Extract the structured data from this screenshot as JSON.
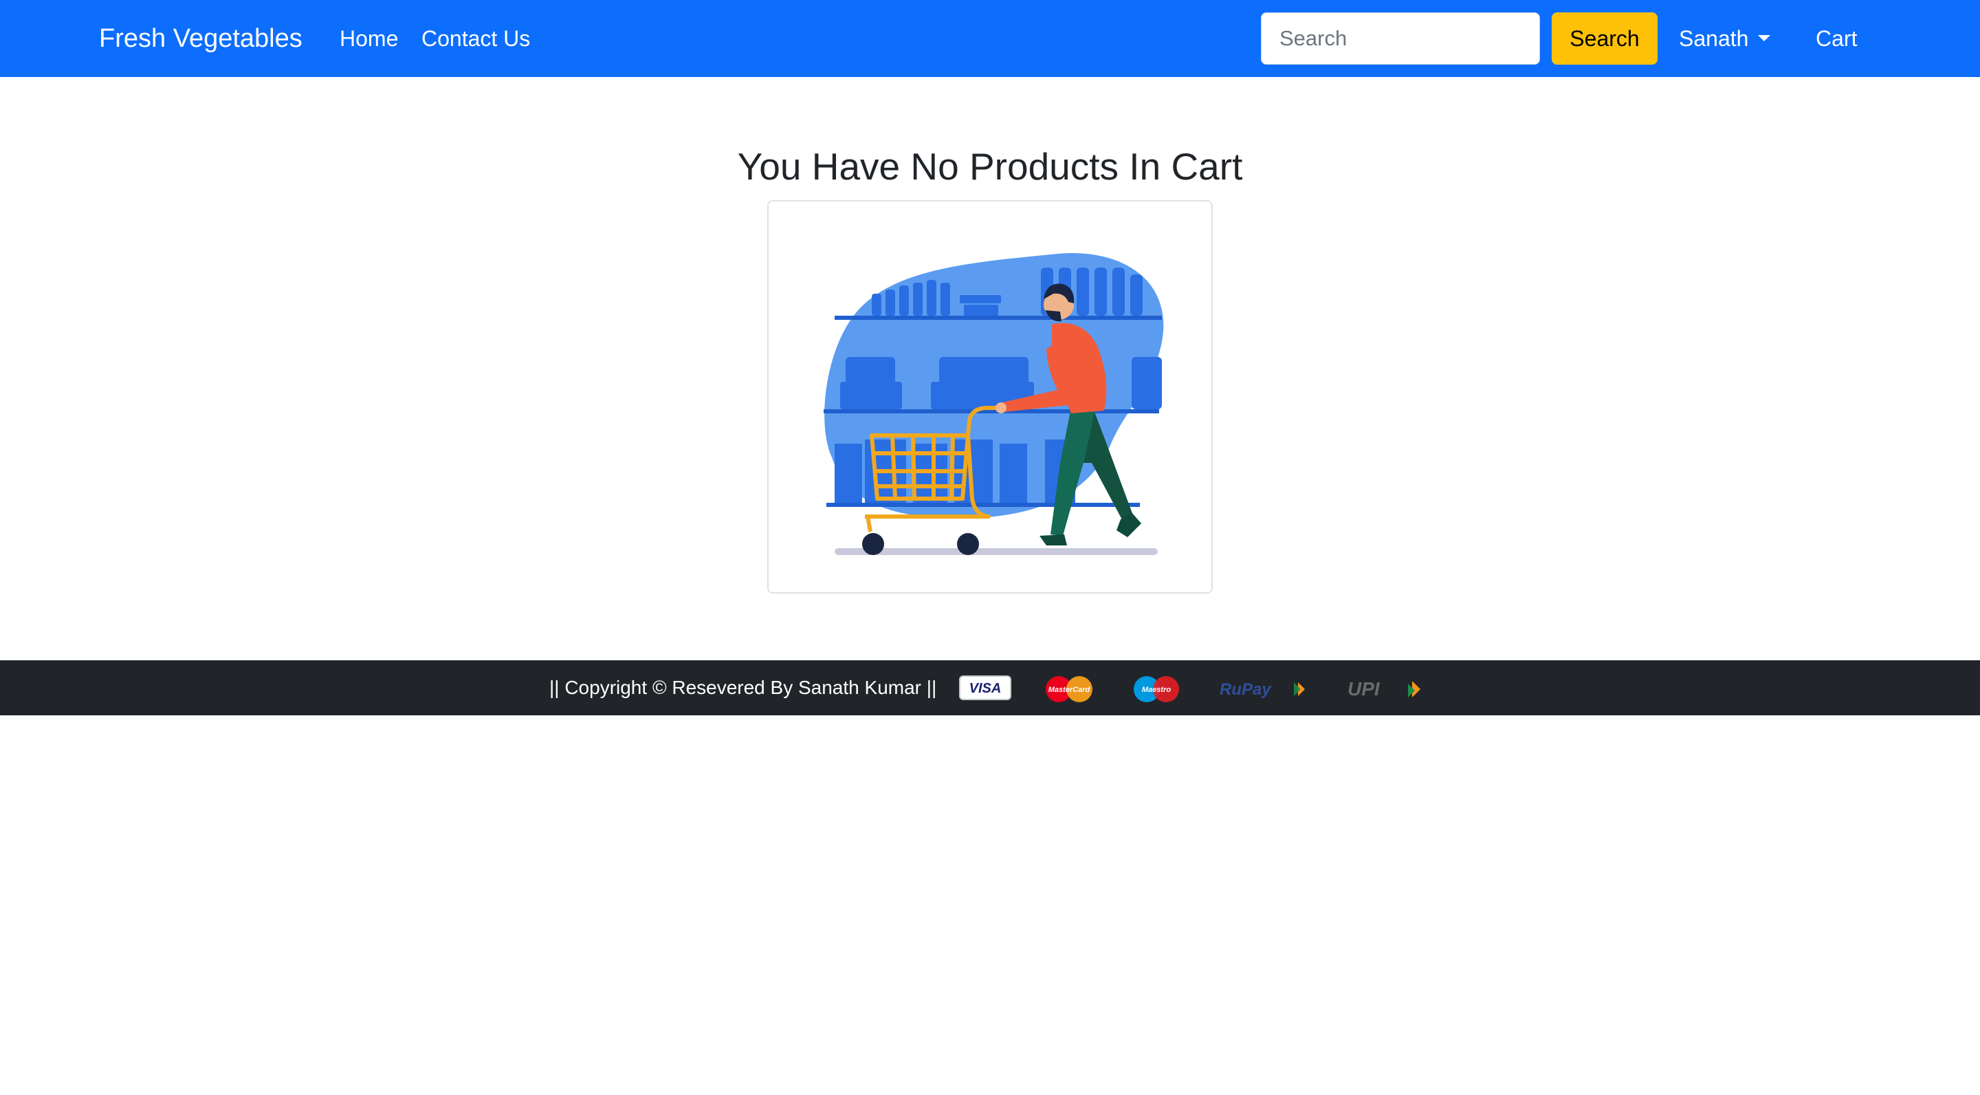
{
  "navbar": {
    "brand": "Fresh Vegetables",
    "links": [
      "Home",
      "Contact Us"
    ],
    "search": {
      "placeholder": "Search",
      "button_label": "Search"
    },
    "user": "Sanath",
    "cart_label": "Cart",
    "background_color": "#0d6efd",
    "search_button_color": "#ffc107"
  },
  "main": {
    "heading": "You Have No Products In Cart",
    "illustration": "empty-cart-shopper-illustration"
  },
  "footer": {
    "copyright": "|| Copyright © Resevered By Sanath Kumar ||",
    "background_color": "#212529",
    "payment_logos": [
      {
        "name": "visa-logo",
        "text": "VISA"
      },
      {
        "name": "mastercard-logo",
        "text": "MasterCard"
      },
      {
        "name": "maestro-logo",
        "text": "Maestro"
      },
      {
        "name": "rupay-logo",
        "text": "RuPay"
      },
      {
        "name": "upi-logo",
        "text": "UPI"
      }
    ]
  }
}
